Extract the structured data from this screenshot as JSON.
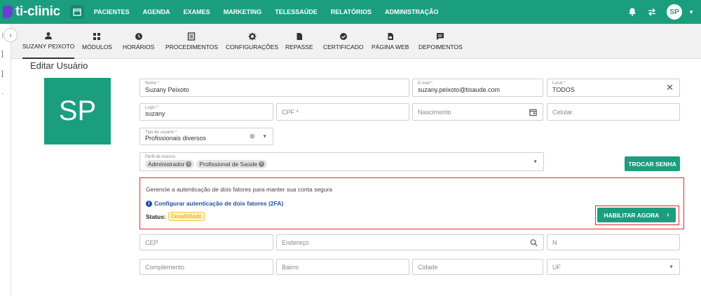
{
  "app": {
    "logo": "ti-clinic"
  },
  "nav": {
    "items": [
      "PACIENTES",
      "AGENDA",
      "EXAMES",
      "MARKETING",
      "TELESSAÚDE",
      "RELATÓRIOS",
      "ADMINISTRAÇÃO"
    ]
  },
  "user": {
    "initials": "SP"
  },
  "subnav": {
    "items": [
      "SUZANY PEIXOTO",
      "MÓDULOS",
      "HORÁRIOS",
      "PROCEDIMENTOS",
      "CONFIGURAÇÕES",
      "REPASSE",
      "CERTIFICADO",
      "PÁGINA WEB",
      "DEPOIMENTOS"
    ]
  },
  "page": {
    "title": "Editar Usuário",
    "avatar_initials": "SP"
  },
  "form": {
    "nome": {
      "label": "Nome *",
      "value": "Suzany Peixoto"
    },
    "email": {
      "label": "E-mail *",
      "value": "suzany.peixoto@tisaude.com"
    },
    "local": {
      "label": "Local *",
      "value": "TODOS"
    },
    "login": {
      "label": "Login *",
      "value": "suzany"
    },
    "cpf": {
      "placeholder": "CPF *"
    },
    "nascimento": {
      "placeholder": "Nascimento"
    },
    "celular": {
      "placeholder": "Celular"
    },
    "tipo": {
      "label": "Tipo de usuário *",
      "value": "Profissionais diversos"
    },
    "perfil": {
      "label": "Perfil de Acesso",
      "chips": [
        "Administrador",
        "Profissional de Saúde"
      ]
    },
    "trocar_senha": "TROCAR SENHA",
    "cep": {
      "placeholder": "CEP"
    },
    "endereco": {
      "placeholder": "Endereço"
    },
    "numero": {
      "placeholder": "N"
    },
    "complemento": {
      "placeholder": "Complemento"
    },
    "bairro": {
      "placeholder": "Bairro"
    },
    "cidade": {
      "placeholder": "Cidade"
    },
    "uf": {
      "placeholder": "UF"
    }
  },
  "twofa": {
    "description": "Gerencie a autenticação de dois fatores para manter sua conta segura",
    "link": "Configurar autenticação de dois fatores (2FA)",
    "status_label": "Status:",
    "status_value": "Desabilitado",
    "button": "HABILITAR AGORA"
  },
  "colors": {
    "brand": "#1a9e7e",
    "highlight": "#e02b2b",
    "badge_bg": "#fff2cc"
  }
}
